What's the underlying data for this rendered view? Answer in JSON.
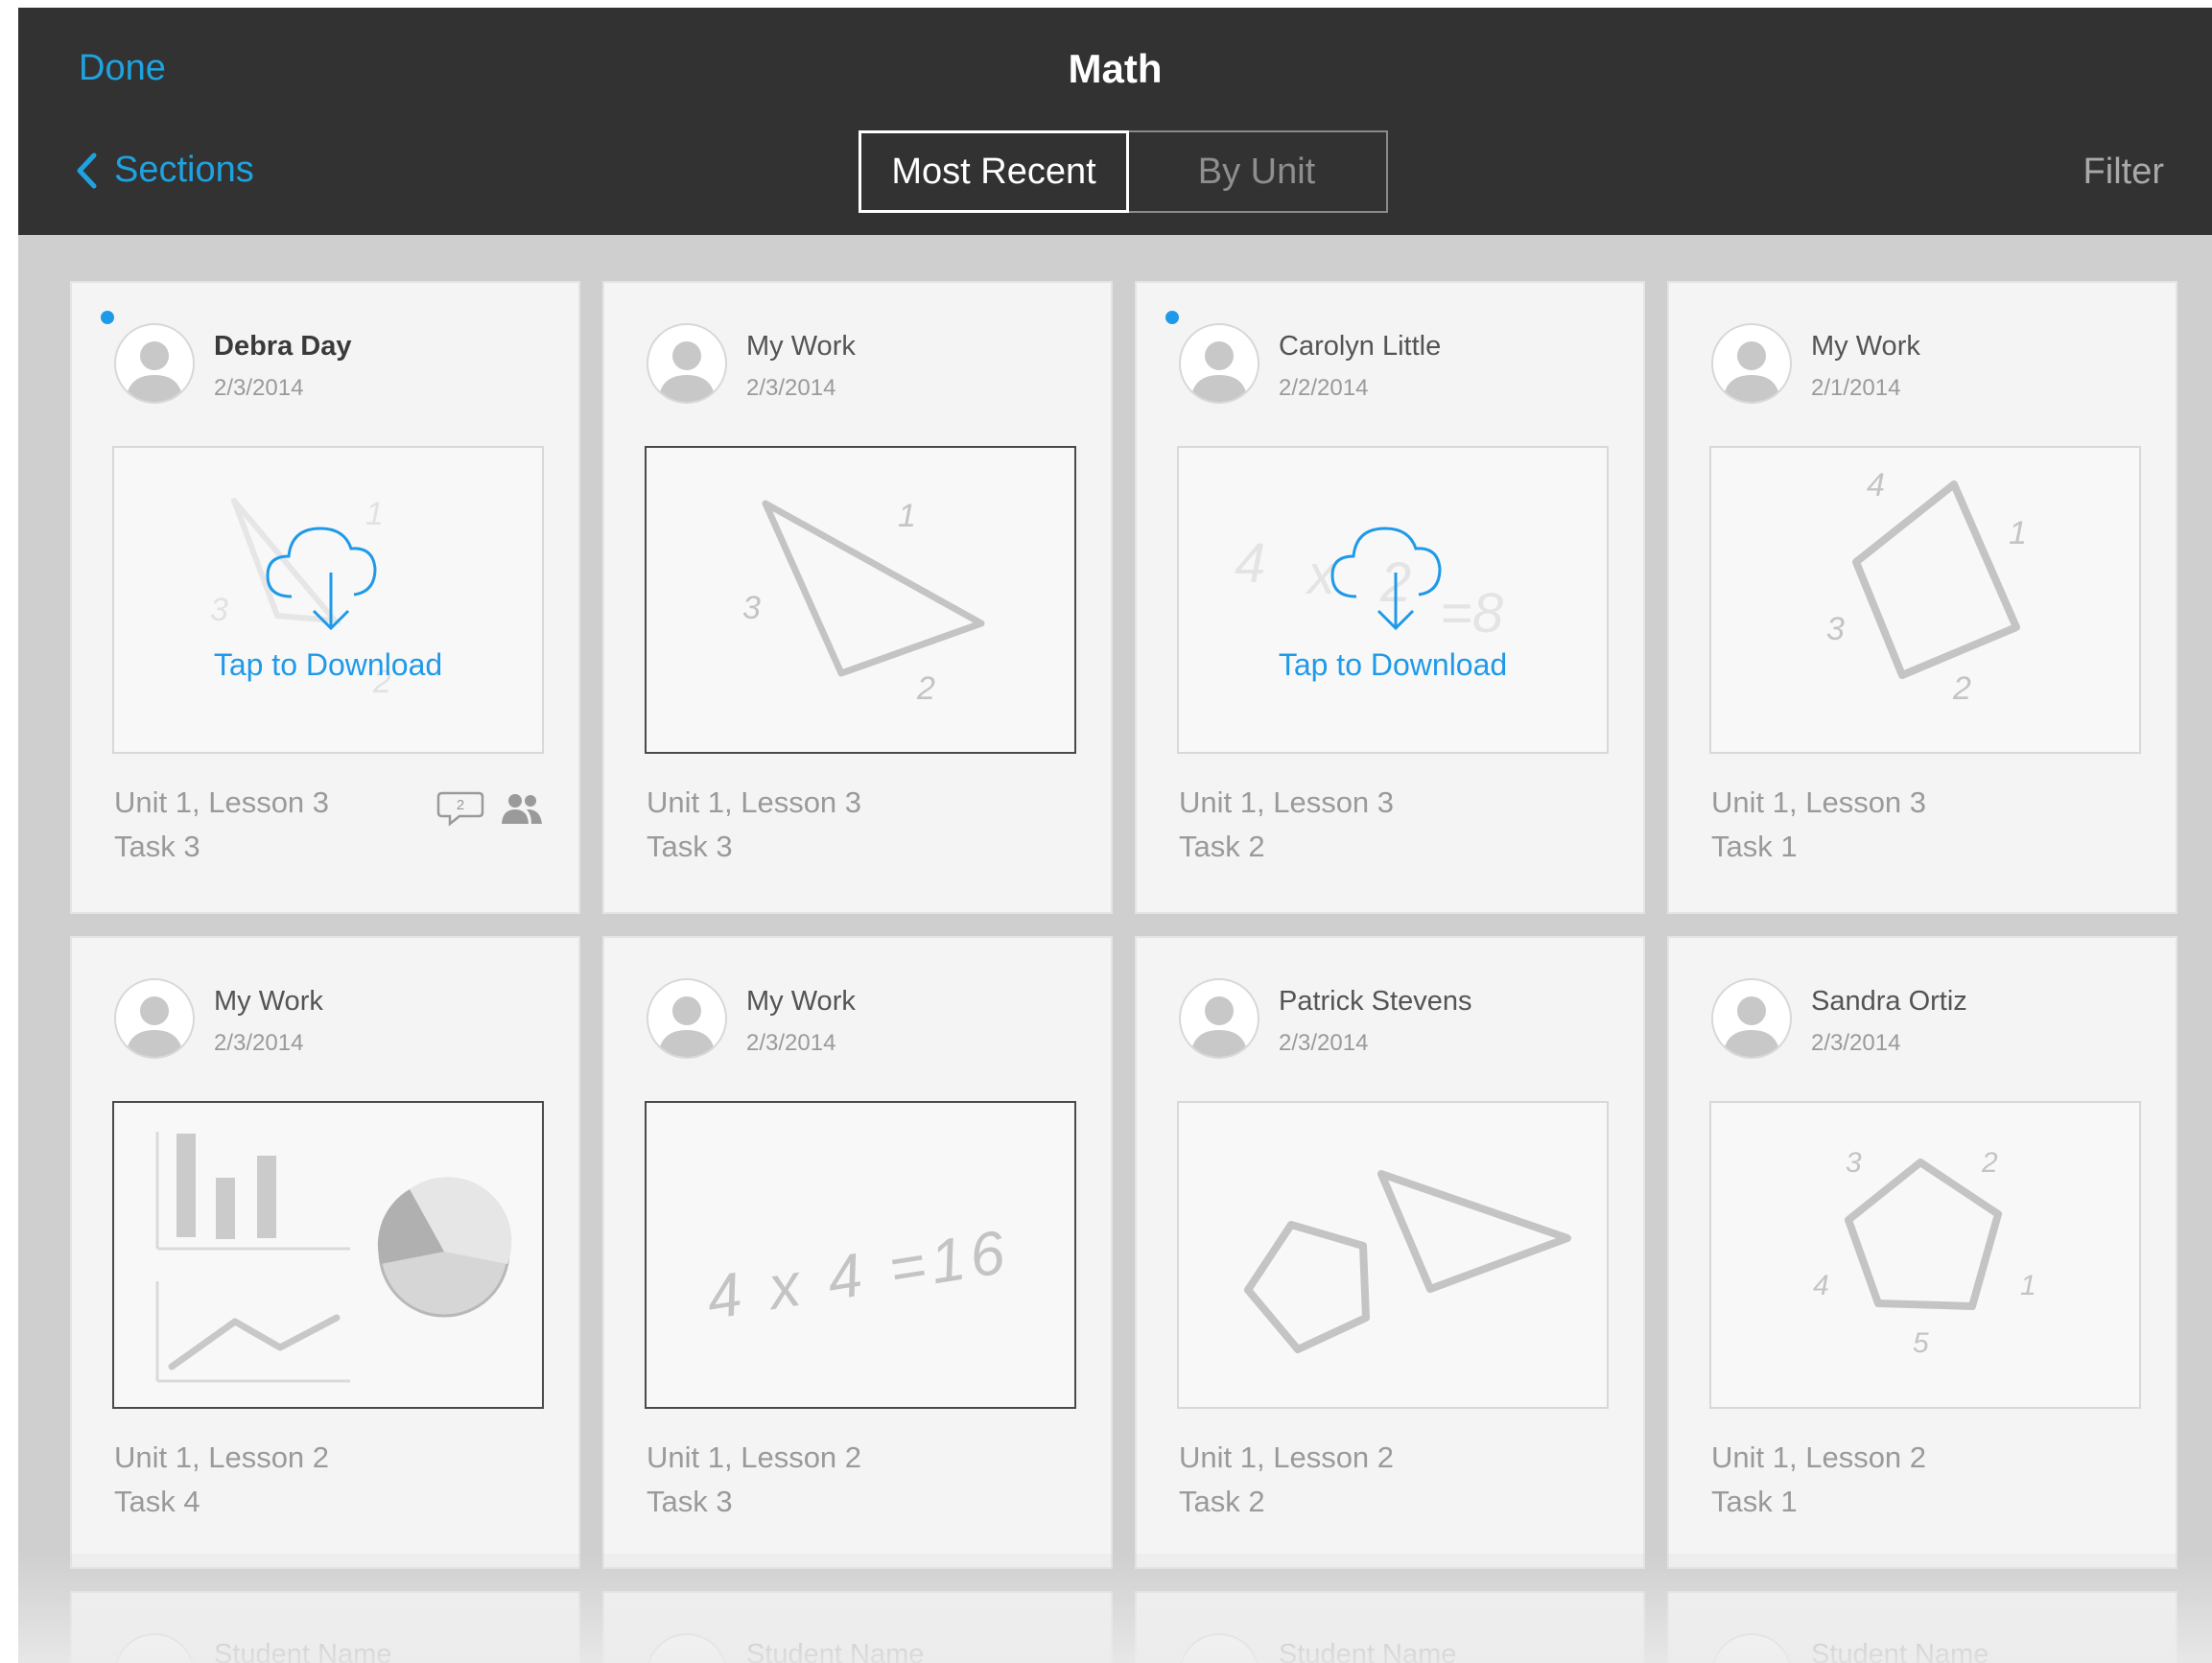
{
  "header": {
    "done_label": "Done",
    "title": "Math",
    "back_label": "Sections",
    "tabs": [
      {
        "label": "Most Recent",
        "active": true
      },
      {
        "label": "By Unit",
        "active": false
      }
    ],
    "filter_label": "Filter"
  },
  "cards": [
    {
      "name": "Debra Day",
      "date": "2/3/2014",
      "lesson": "Unit 1, Lesson 3",
      "task": "Task 3",
      "unread": true,
      "download": "Tap to Download",
      "comment_count": "2"
    },
    {
      "name": "My Work",
      "date": "2/3/2014",
      "lesson": "Unit 1, Lesson 3",
      "task": "Task 3"
    },
    {
      "name": "Carolyn Little",
      "date": "2/2/2014",
      "lesson": "Unit 1, Lesson 3",
      "task": "Task 2",
      "unread": true,
      "download": "Tap to Download"
    },
    {
      "name": "My Work",
      "date": "2/1/2014",
      "lesson": "Unit 1, Lesson 3",
      "task": "Task 1"
    },
    {
      "name": "My Work",
      "date": "2/3/2014",
      "lesson": "Unit 1, Lesson 2",
      "task": "Task 4"
    },
    {
      "name": "My Work",
      "date": "2/3/2014",
      "lesson": "Unit 1, Lesson 2",
      "task": "Task 3"
    },
    {
      "name": "Patrick Stevens",
      "date": "2/3/2014",
      "lesson": "Unit 1, Lesson 2",
      "task": "Task 2"
    },
    {
      "name": "Sandra Ortiz",
      "date": "2/3/2014",
      "lesson": "Unit 1, Lesson 2",
      "task": "Task 1"
    }
  ],
  "sketches": {
    "triangle_labels": [
      "1",
      "2",
      "3"
    ],
    "equation_ghost": [
      "4",
      "x",
      "2",
      "=8"
    ],
    "quad_labels": [
      "4",
      "1",
      "3",
      "2"
    ],
    "equation": "4 x 4 =16",
    "pentagon_labels": [
      "3",
      "2",
      "4",
      "1",
      "5"
    ]
  },
  "partial_cards": [
    {
      "name": "Student Name"
    },
    {
      "name": "Student Name"
    },
    {
      "name": "Student Name"
    },
    {
      "name": "Student Name"
    }
  ],
  "colors": {
    "accent": "#1ea3e0",
    "header_bg": "#323232",
    "unread_dot": "#1f9ae8"
  }
}
